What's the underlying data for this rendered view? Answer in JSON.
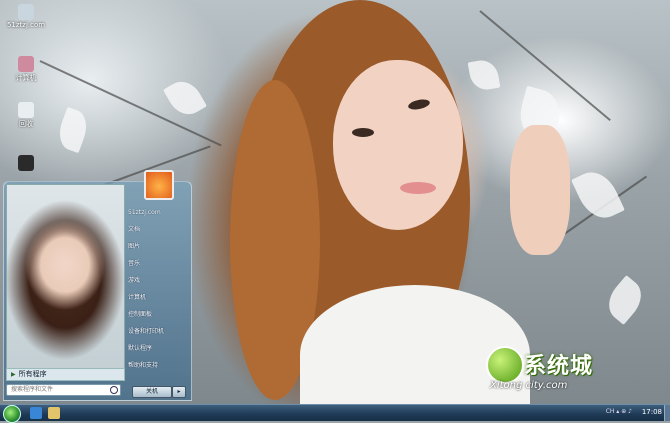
{
  "desktop_icons": [
    {
      "label": "51ztzj.com",
      "color": "#c9d6e0"
    },
    {
      "label": "计算机",
      "color": "#d08aa0"
    },
    {
      "label": "回收",
      "color": "#e9eef0"
    },
    {
      "label": "",
      "color": "#2a2a2a"
    }
  ],
  "start_menu": {
    "items": [
      "51ztzj.com",
      "文档",
      "图片",
      "音乐",
      "游戏",
      "计算机",
      "控制面板",
      "设备和打印机",
      "默认程序",
      "帮助和支持"
    ],
    "all_programs": "所有程序",
    "search_placeholder": "搜索程序和文件",
    "shutdown": "关机",
    "shutdown_arrow": "▸"
  },
  "watermark": {
    "cn": "系统城",
    "en": "Xitong city.com"
  },
  "taskbar": {
    "tray_text": "CH ▴ ⊕ ♪",
    "clock": "17:08"
  },
  "colors": {
    "taskbar": "#1e3955",
    "orb": "#2d8f2d",
    "accent": "#4f9b12"
  }
}
